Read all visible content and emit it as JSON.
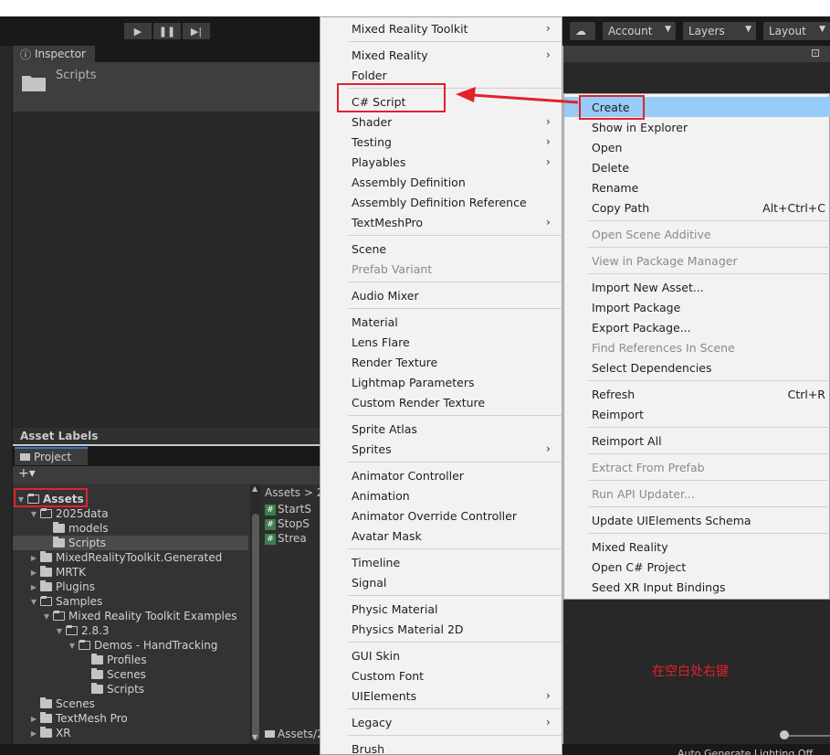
{
  "toolbar": {
    "play_icon": "play-icon",
    "pause_icon": "pause-icon",
    "step_icon": "step-icon",
    "account_label": "Account",
    "layers_label": "Layers",
    "layout_label": "Layout"
  },
  "inspector": {
    "tab_label": "Inspector",
    "title": "Scripts"
  },
  "asset_labels": "Asset Labels",
  "project": {
    "tab_label": "Project",
    "add_label": "+▾",
    "tree": [
      {
        "label": "Assets",
        "depth": 0,
        "expanded": true,
        "selected": false
      },
      {
        "label": "2025data",
        "depth": 1,
        "expanded": true
      },
      {
        "label": "models",
        "depth": 2
      },
      {
        "label": "Scripts",
        "depth": 2,
        "selected": true
      },
      {
        "label": "MixedRealityToolkit.Generated",
        "depth": 1,
        "collapsed": true
      },
      {
        "label": "MRTK",
        "depth": 1,
        "collapsed": true
      },
      {
        "label": "Plugins",
        "depth": 1,
        "collapsed": true
      },
      {
        "label": "Samples",
        "depth": 1,
        "expanded": true
      },
      {
        "label": "Mixed Reality Toolkit Examples",
        "depth": 2,
        "expanded": true
      },
      {
        "label": "2.8.3",
        "depth": 3,
        "expanded": true
      },
      {
        "label": "Demos - HandTracking",
        "depth": 4,
        "expanded": true
      },
      {
        "label": "Profiles",
        "depth": 5
      },
      {
        "label": "Scenes",
        "depth": 5
      },
      {
        "label": "Scripts",
        "depth": 5
      },
      {
        "label": "Scenes",
        "depth": 1
      },
      {
        "label": "TextMesh Pro",
        "depth": 1,
        "collapsed": true
      },
      {
        "label": "XR",
        "depth": 1,
        "collapsed": true
      }
    ],
    "breadcrumb": "Assets > 2",
    "files": [
      "StartS",
      "StopS",
      "Strea"
    ],
    "footer_path": "Assets/2"
  },
  "status": {
    "auto_generate": "Auto Generate Lighting Off"
  },
  "create_menu": {
    "items": [
      {
        "label": "Mixed Reality Toolkit",
        "submenu": true
      },
      {
        "sep": true
      },
      {
        "label": "Mixed Reality",
        "submenu": true
      },
      {
        "label": "Folder"
      },
      {
        "sep": true
      },
      {
        "label": "C# Script"
      },
      {
        "label": "Shader",
        "submenu": true
      },
      {
        "label": "Testing",
        "submenu": true
      },
      {
        "label": "Playables",
        "submenu": true
      },
      {
        "label": "Assembly Definition"
      },
      {
        "label": "Assembly Definition Reference"
      },
      {
        "label": "TextMeshPro",
        "submenu": true
      },
      {
        "sep": true
      },
      {
        "label": "Scene"
      },
      {
        "label": "Prefab Variant",
        "disabled": true
      },
      {
        "sep": true
      },
      {
        "label": "Audio Mixer"
      },
      {
        "sep": true
      },
      {
        "label": "Material"
      },
      {
        "label": "Lens Flare"
      },
      {
        "label": "Render Texture"
      },
      {
        "label": "Lightmap Parameters"
      },
      {
        "label": "Custom Render Texture"
      },
      {
        "sep": true
      },
      {
        "label": "Sprite Atlas"
      },
      {
        "label": "Sprites",
        "submenu": true
      },
      {
        "sep": true
      },
      {
        "label": "Animator Controller"
      },
      {
        "label": "Animation"
      },
      {
        "label": "Animator Override Controller"
      },
      {
        "label": "Avatar Mask"
      },
      {
        "sep": true
      },
      {
        "label": "Timeline"
      },
      {
        "label": "Signal"
      },
      {
        "sep": true
      },
      {
        "label": "Physic Material"
      },
      {
        "label": "Physics Material 2D"
      },
      {
        "sep": true
      },
      {
        "label": "GUI Skin"
      },
      {
        "label": "Custom Font"
      },
      {
        "label": "UIElements",
        "submenu": true
      },
      {
        "sep": true
      },
      {
        "label": "Legacy",
        "submenu": true
      },
      {
        "sep": true
      },
      {
        "label": "Brush"
      }
    ]
  },
  "context_menu": {
    "items": [
      {
        "label": "Create",
        "highlighted": true
      },
      {
        "label": "Show in Explorer"
      },
      {
        "label": "Open"
      },
      {
        "label": "Delete"
      },
      {
        "label": "Rename"
      },
      {
        "label": "Copy Path",
        "shortcut": "Alt+Ctrl+C"
      },
      {
        "sep": true
      },
      {
        "label": "Open Scene Additive",
        "disabled": true
      },
      {
        "sep": true
      },
      {
        "label": "View in Package Manager",
        "disabled": true
      },
      {
        "sep": true
      },
      {
        "label": "Import New Asset..."
      },
      {
        "label": "Import Package"
      },
      {
        "label": "Export Package..."
      },
      {
        "label": "Find References In Scene",
        "disabled": true
      },
      {
        "label": "Select Dependencies"
      },
      {
        "sep": true
      },
      {
        "label": "Refresh",
        "shortcut": "Ctrl+R"
      },
      {
        "label": "Reimport"
      },
      {
        "sep": true
      },
      {
        "label": "Reimport All"
      },
      {
        "sep": true
      },
      {
        "label": "Extract From Prefab",
        "disabled": true
      },
      {
        "sep": true
      },
      {
        "label": "Run API Updater...",
        "disabled": true
      },
      {
        "sep": true
      },
      {
        "label": "Update UIElements Schema"
      },
      {
        "sep": true
      },
      {
        "label": "Mixed Reality"
      },
      {
        "label": "Open C# Project"
      },
      {
        "label": "Seed XR Input Bindings"
      }
    ]
  },
  "annotation": {
    "note": "在空白处右键",
    "color": "#e0222a"
  }
}
